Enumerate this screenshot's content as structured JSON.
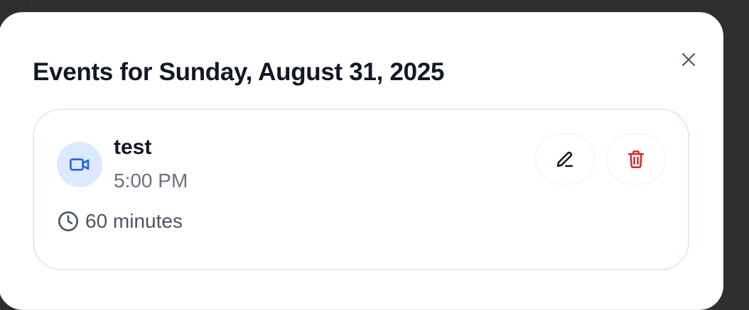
{
  "modal": {
    "title": "Events for Sunday, August 31, 2025",
    "close_icon": "close-icon"
  },
  "event": {
    "type_icon": "video-camera-icon",
    "name": "test",
    "time": "5:00 PM",
    "duration": "60 minutes",
    "duration_icon": "clock-icon",
    "edit_icon": "pencil-icon",
    "delete_icon": "trash-icon"
  },
  "colors": {
    "accent_blue": "#2563eb",
    "accent_blue_bg": "#dbeafe",
    "danger_red": "#dc2626",
    "title_text": "#141824",
    "muted_text": "#6b7280"
  }
}
